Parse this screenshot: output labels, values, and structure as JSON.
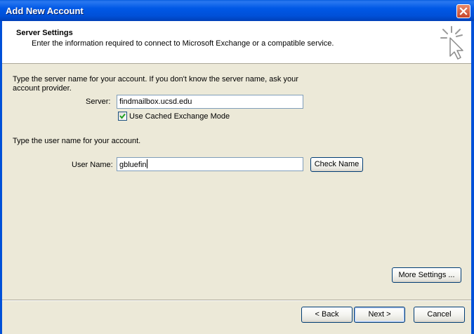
{
  "window": {
    "title": "Add New Account"
  },
  "header": {
    "title": "Server Settings",
    "description": "Enter the information required to connect to Microsoft Exchange or a compatible service."
  },
  "server_section": {
    "instructions_line1": "Type the server name for your account. If you don't know the server name, ask your",
    "instructions_line2": "account provider.",
    "server_label": "Server:",
    "server_value": "findmailbox.ucsd.edu",
    "cached_mode_label": "Use Cached Exchange Mode",
    "cached_mode_checked": true
  },
  "user_section": {
    "instructions": "Type the user name for your account.",
    "username_label": "User Name:",
    "username_value": "gbluefin",
    "check_name_label": "Check Name"
  },
  "buttons": {
    "more_settings": "More Settings ...",
    "back": "< Back",
    "next": "Next >",
    "cancel": "Cancel"
  },
  "icons": {
    "close": "close-icon",
    "wizard": "cursor-sparkle-icon",
    "check": "checkmark-icon"
  },
  "colors": {
    "titlebar": "#0054e3",
    "dialog_bg": "#ece9d8",
    "close_button": "#d9532f"
  }
}
